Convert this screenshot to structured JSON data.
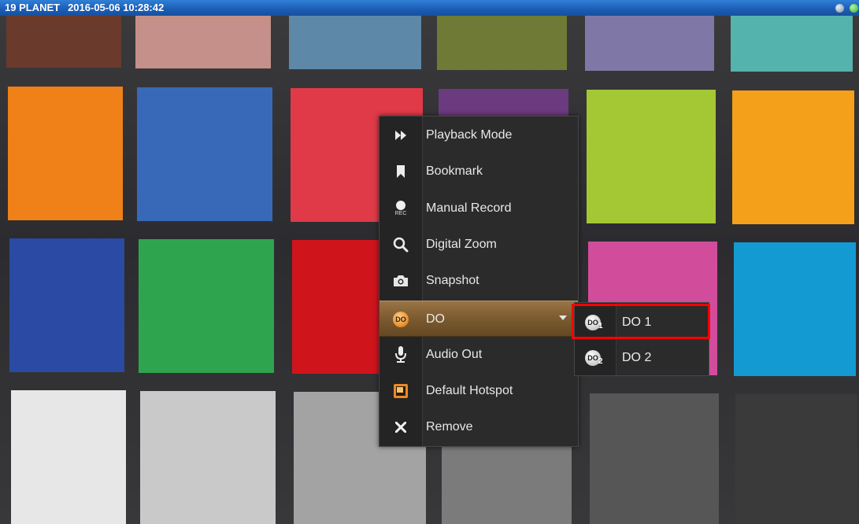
{
  "title_bar": {
    "camera_name": "19 PLANET",
    "timestamp": "2016-05-06 10:28:42"
  },
  "video": {
    "patch_colors": [
      "#6a3a2c",
      "#c49089",
      "#5e88a8",
      "#6f7a36",
      "#7f78a6",
      "#55b3ae",
      "#f08018",
      "#3869b8",
      "#e03a48",
      "#6c3a7e",
      "#a4c834",
      "#f4a01a",
      "#2a4aa3",
      "#2fa44e",
      "#d0141c",
      "#e0b40a",
      "#d24c9c",
      "#139ad2",
      "#e7e7e7",
      "#c9c9c9",
      "#a3a3a3",
      "#7b7b7b",
      "#565656",
      "#3a3a3a"
    ]
  },
  "context_menu": {
    "items": [
      {
        "label": "Playback Mode",
        "icon": "fast-forward-icon"
      },
      {
        "label": "Bookmark",
        "icon": "bookmark-icon"
      },
      {
        "label": "Manual Record",
        "icon": "record-icon",
        "icon_text": "REC"
      },
      {
        "label": "Digital Zoom",
        "icon": "magnifier-icon"
      },
      {
        "label": "Snapshot",
        "icon": "camera-icon"
      },
      {
        "label": "DO",
        "icon": "do-icon",
        "icon_text": "DO",
        "active": true
      },
      {
        "label": "Audio Out",
        "icon": "microphone-icon"
      },
      {
        "label": "Default Hotspot",
        "icon": "hotspot-icon"
      },
      {
        "label": "Remove",
        "icon": "close-icon"
      }
    ]
  },
  "do_submenu": {
    "items": [
      {
        "label": "DO 1",
        "icon": "do-1-icon",
        "icon_text": "DO",
        "index": "1",
        "highlighted": true
      },
      {
        "label": "DO 2",
        "icon": "do-2-icon",
        "icon_text": "DO",
        "index": "2"
      }
    ]
  },
  "colors": {
    "menu_bg": "#2b2b2b",
    "active_item": "#7b5a30",
    "titlebar": "#1d5fb7",
    "highlight_box": "#ff0000"
  }
}
